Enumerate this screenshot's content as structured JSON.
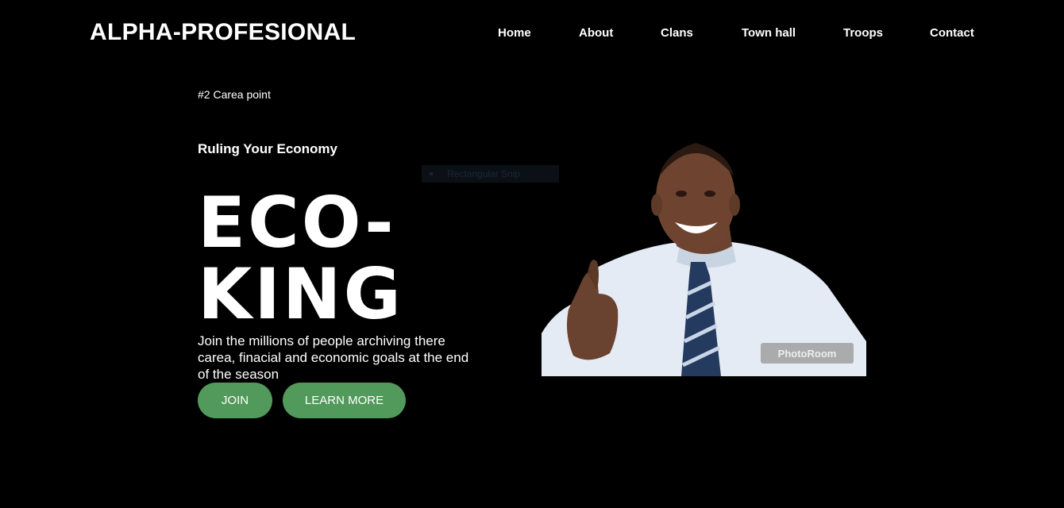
{
  "header": {
    "logo": "ALPHA-PROFESIONAL",
    "nav": [
      "Home",
      "About",
      "Clans",
      "Town hall",
      "Troops",
      "Contact"
    ]
  },
  "hero": {
    "eyebrow": "#2 Carea point",
    "subheading": "Ruling Your Economy",
    "title_line1": "ECO-",
    "title_line2": "KING",
    "description": "Join the millions of people archiving there carea, finacial and economic goals at the end of the season",
    "join_label": "JOIN",
    "learn_label": "LEARN MORE"
  },
  "snip_overlay": "Rectangular Snip",
  "photo": {
    "watermark": "PhotoRoom"
  },
  "colors": {
    "background": "#000000",
    "button": "#529a5b",
    "text": "#ffffff"
  }
}
